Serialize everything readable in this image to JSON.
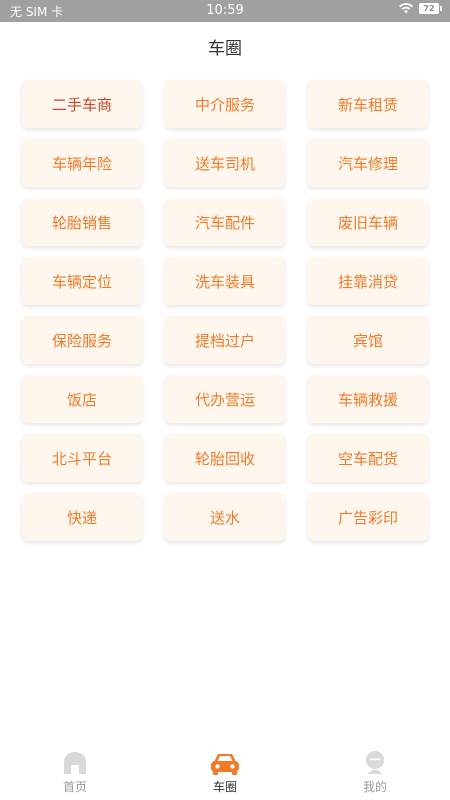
{
  "status_bar": {
    "carrier": "无 SIM 卡",
    "time": "10:59",
    "battery": "72"
  },
  "page": {
    "title": "车圈"
  },
  "categories": [
    "二手车商",
    "中介服务",
    "新车租赁",
    "车辆年险",
    "送车司机",
    "汽车修理",
    "轮胎销售",
    "汽车配件",
    "废旧车辆",
    "车辆定位",
    "洗车装具",
    "挂靠消贷",
    "保险服务",
    "提档过户",
    "宾馆",
    "饭店",
    "代办营运",
    "车辆救援",
    "北斗平台",
    "轮胎回收",
    "空车配货",
    "快递",
    "送水",
    "广告彩印"
  ],
  "nav": {
    "items": [
      {
        "label": "首页",
        "icon": "home-icon"
      },
      {
        "label": "车圈",
        "icon": "car-icon",
        "active": true
      },
      {
        "label": "我的",
        "icon": "profile-icon"
      }
    ]
  },
  "colors": {
    "accent": "#ef7a28",
    "accent_dark": "#c8452a",
    "tile_bg": "#fff6ee",
    "status_bar_bg": "#a0a0a0",
    "nav_inactive": "#d9d9d9"
  }
}
